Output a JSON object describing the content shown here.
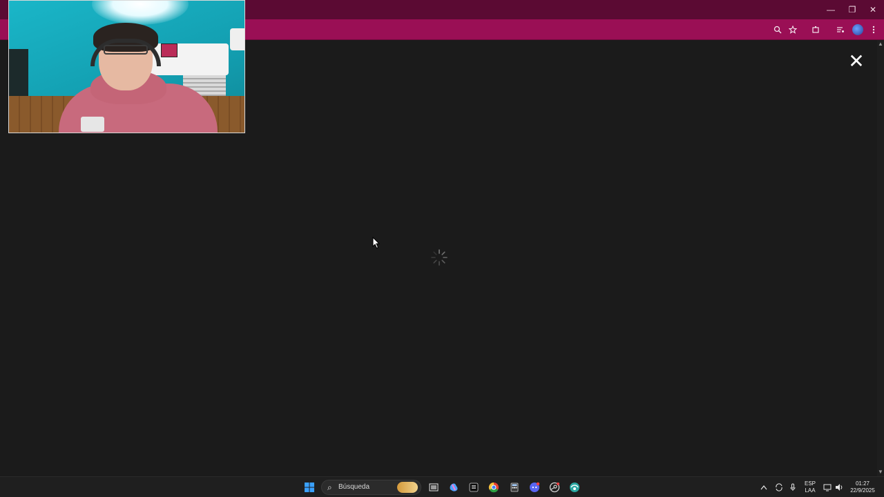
{
  "window": {
    "minimize_glyph": "—",
    "maximize_glyph": "❐",
    "close_glyph": "✕"
  },
  "toolbar": {
    "icons": [
      "zoom-icon",
      "star-icon",
      "extensions-icon",
      "media-icon",
      "profile-avatar",
      "menu-kebab-icon"
    ]
  },
  "overlay": {
    "close_glyph": "✕"
  },
  "taskbar": {
    "search_placeholder": "Búsqueda",
    "lang_top": "ESP",
    "lang_bottom": "LAA",
    "time": "01:27",
    "date": "22/9/2025"
  },
  "colors": {
    "titlebar": "#5b0a33",
    "toolbar": "#9a0f55",
    "page_bg": "#1b1b1b",
    "taskbar": "#1f1f1f"
  }
}
